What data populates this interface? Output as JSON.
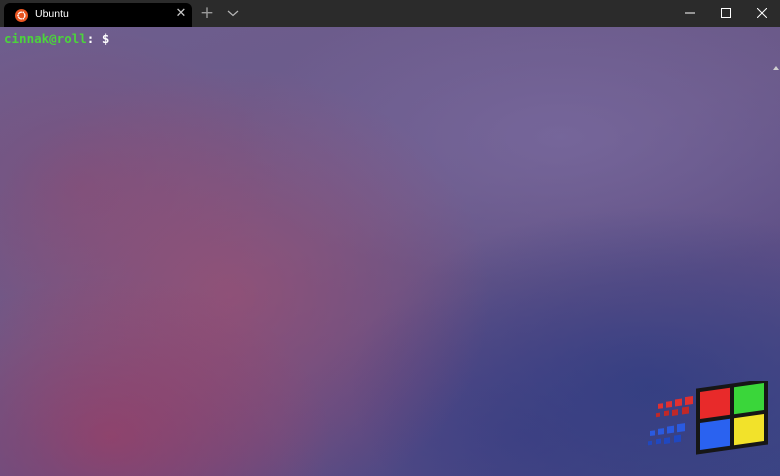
{
  "window": {
    "tab_title": "Ubuntu",
    "tab_icon": "ubuntu-icon",
    "tab_close": "✕",
    "new_tab": "+",
    "dropdown_icon": "chevron-down-icon",
    "controls": [
      "minimize-icon",
      "maximize-icon",
      "close-icon"
    ]
  },
  "terminal": {
    "prompt_user_host": "cinnak@roll",
    "prompt_colon": ":",
    "prompt_symbol": " $"
  },
  "colors": {
    "titlebar": "#2b2b2b",
    "active_tab": "#000000",
    "ubuntu_orange": "#e95420",
    "prompt_green": "#4cd43c"
  },
  "decorations": {
    "logo": "windows-98-logo"
  }
}
